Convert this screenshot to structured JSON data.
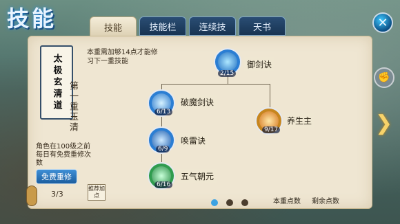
{
  "title": "技能",
  "tabs": [
    {
      "label": "技能",
      "active": true
    },
    {
      "label": "技能栏",
      "active": false
    },
    {
      "label": "连续技",
      "active": false
    },
    {
      "label": "天书",
      "active": false
    }
  ],
  "left": {
    "badge_text": "太极玄清道",
    "tier_name": "第一重玉清",
    "note": "角色在100级之前每日有免费重修次数",
    "free_button": "免费重修",
    "count": "3/3"
  },
  "requirement": "本重需加够14点才能修习下一重技能",
  "recommend_label": "推荐加点",
  "skills": [
    {
      "name": "御剑诀",
      "level": "2/15"
    },
    {
      "name": "破魔剑诀",
      "level": "6/13"
    },
    {
      "name": "养生主",
      "level": "9/17"
    },
    {
      "name": "唤雷诀",
      "level": "6/9"
    },
    {
      "name": "五气朝元",
      "level": "6/16"
    }
  ],
  "points": {
    "tier_points_label": "本重点数",
    "remaining_points_label": "剩余点数"
  }
}
